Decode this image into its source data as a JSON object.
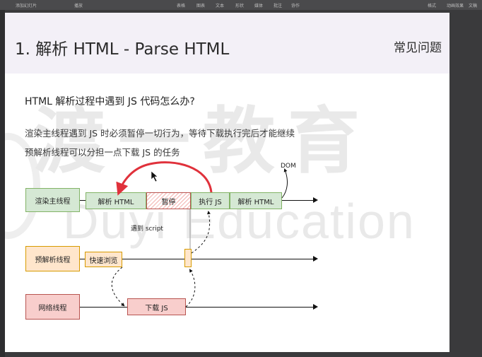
{
  "toolbar": {
    "items": [
      "添加幻灯片",
      "播放",
      "",
      "表格",
      "图表",
      "文本",
      "形状",
      "媒体",
      "批注",
      "协作",
      "",
      "格式",
      "动画效果",
      "文稿"
    ]
  },
  "slide": {
    "title": "1. 解析 HTML - Parse HTML",
    "faq_label": "常见问题",
    "question": "HTML  解析过程中遇到  JS  代码怎么办?",
    "lines": [
      "渲染主线程遇到  JS  时必须暂停一切行为，等待下载执行完后才能继续",
      "预解析线程可以分担一点下载  JS  的任务"
    ]
  },
  "watermark": {
    "cn": "渡一教育",
    "en": "Duyi Education"
  },
  "diagram": {
    "main_thread": "渲染主线程",
    "parse_html_1": "解析 HTML",
    "pause": "暂停",
    "exec_js": "执行 JS",
    "parse_html_2": "解析 HTML",
    "dom_label": "DOM",
    "encounter_script": "遇到 script",
    "preparse_thread": "预解析线程",
    "quick_browse": "快速浏览",
    "network_thread": "网络线程",
    "download_js": "下载 JS"
  },
  "colors": {
    "green_fill": "#d5e8d4",
    "orange_fill": "#ffe6cc",
    "red_fill": "#f8cecc",
    "arrow_red": "#e0313b",
    "header_bg": "#f3f0f7"
  }
}
